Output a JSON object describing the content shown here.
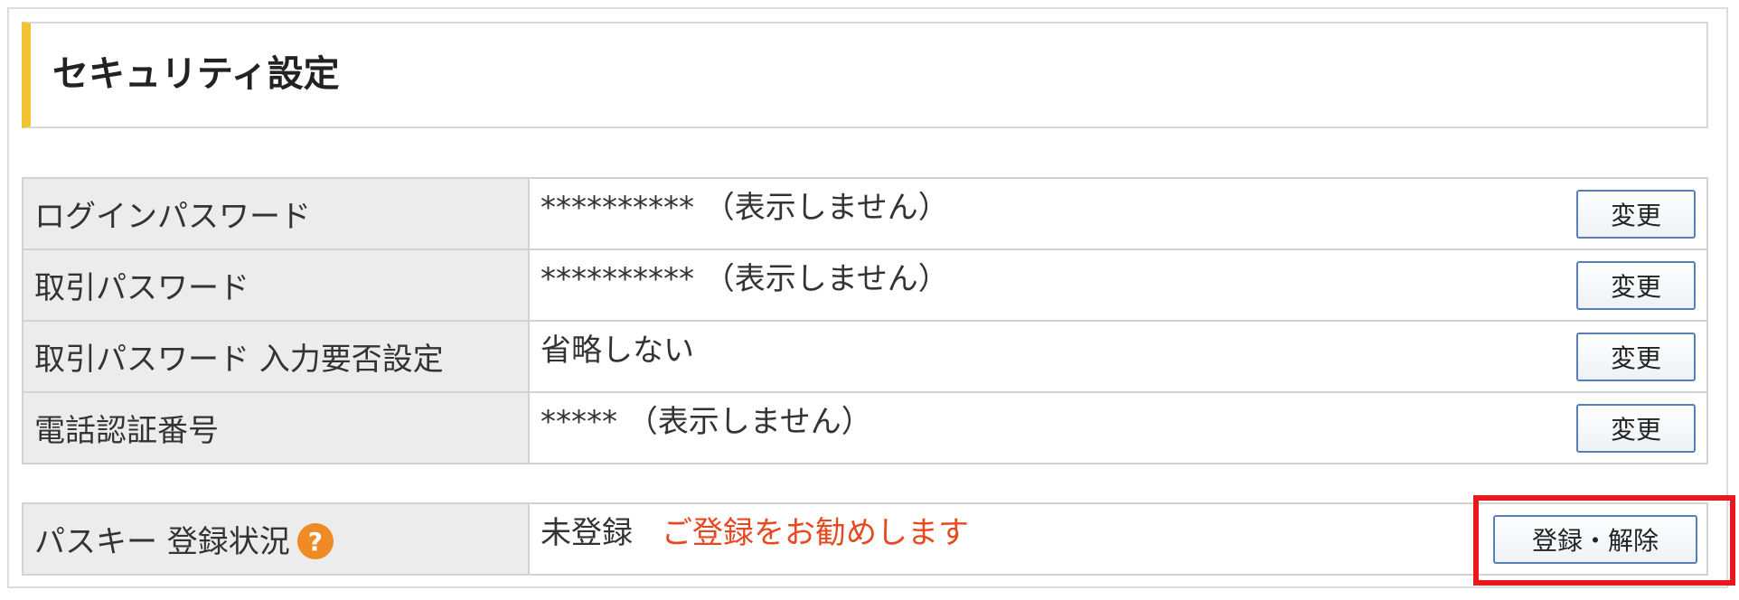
{
  "section": {
    "title": "セキュリティ設定"
  },
  "rows": [
    {
      "label": "ログインパスワード",
      "value": "********** （表示しません）",
      "button": "変更"
    },
    {
      "label": "取引パスワード",
      "value": "********** （表示しません）",
      "button": "変更"
    },
    {
      "label": "取引パスワード 入力要否設定",
      "value": "省略しない",
      "button": "変更"
    },
    {
      "label": "電話認証番号",
      "value": "***** （表示しません）",
      "button": "変更"
    }
  ],
  "passkey": {
    "label": "パスキー 登録状況",
    "help_glyph": "?",
    "status": "未登録",
    "recommend": "ご登録をお勧めします",
    "button": "登録・解除"
  },
  "colors": {
    "accent_bar": "#f2c230",
    "highlight": "#e8181e",
    "recommend_text": "#e8481e",
    "help_icon": "#f08a24"
  }
}
